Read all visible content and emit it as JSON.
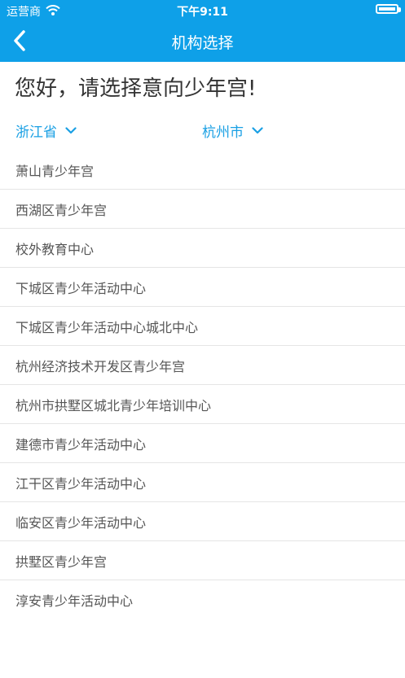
{
  "status_bar": {
    "carrier": "运营商",
    "time": "下午9:11"
  },
  "nav": {
    "title": "机构选择",
    "back_icon": "chevron-left-icon"
  },
  "greeting": "您好，请选择意向少年宫!",
  "filters": {
    "province": "浙江省",
    "city": "杭州市",
    "dropdown_icon": "chevron-down-icon"
  },
  "institutions": [
    "萧山青少年宫",
    "西湖区青少年宫",
    "校外教育中心",
    "下城区青少年活动中心",
    "下城区青少年活动中心城北中心",
    "杭州经济技术开发区青少年宫",
    "杭州市拱墅区城北青少年培训中心",
    "建德市青少年活动中心",
    "江干区青少年活动中心",
    "临安区青少年活动中心",
    "拱墅区青少年宫",
    "淳安青少年活动中心"
  ],
  "colors": {
    "primary": "#0ea0e8",
    "accent_text": "#1aa0e4"
  }
}
